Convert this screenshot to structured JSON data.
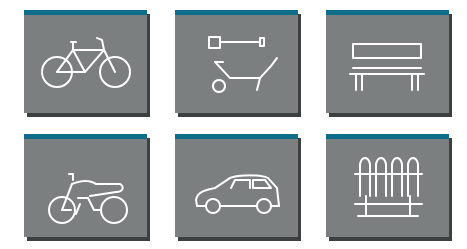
{
  "colors": {
    "tile_background": "#7b7f80",
    "tile_shadow": "#3d4041",
    "accent_bar": "#0d6d8a",
    "icon_stroke": "#ffffff"
  },
  "tiles": [
    {
      "icon": "bicycle-icon"
    },
    {
      "icon": "wheelbarrow-shovel-icon"
    },
    {
      "icon": "bench-icon"
    },
    {
      "icon": "motorcycle-icon"
    },
    {
      "icon": "car-icon"
    },
    {
      "icon": "fence-icon"
    }
  ]
}
